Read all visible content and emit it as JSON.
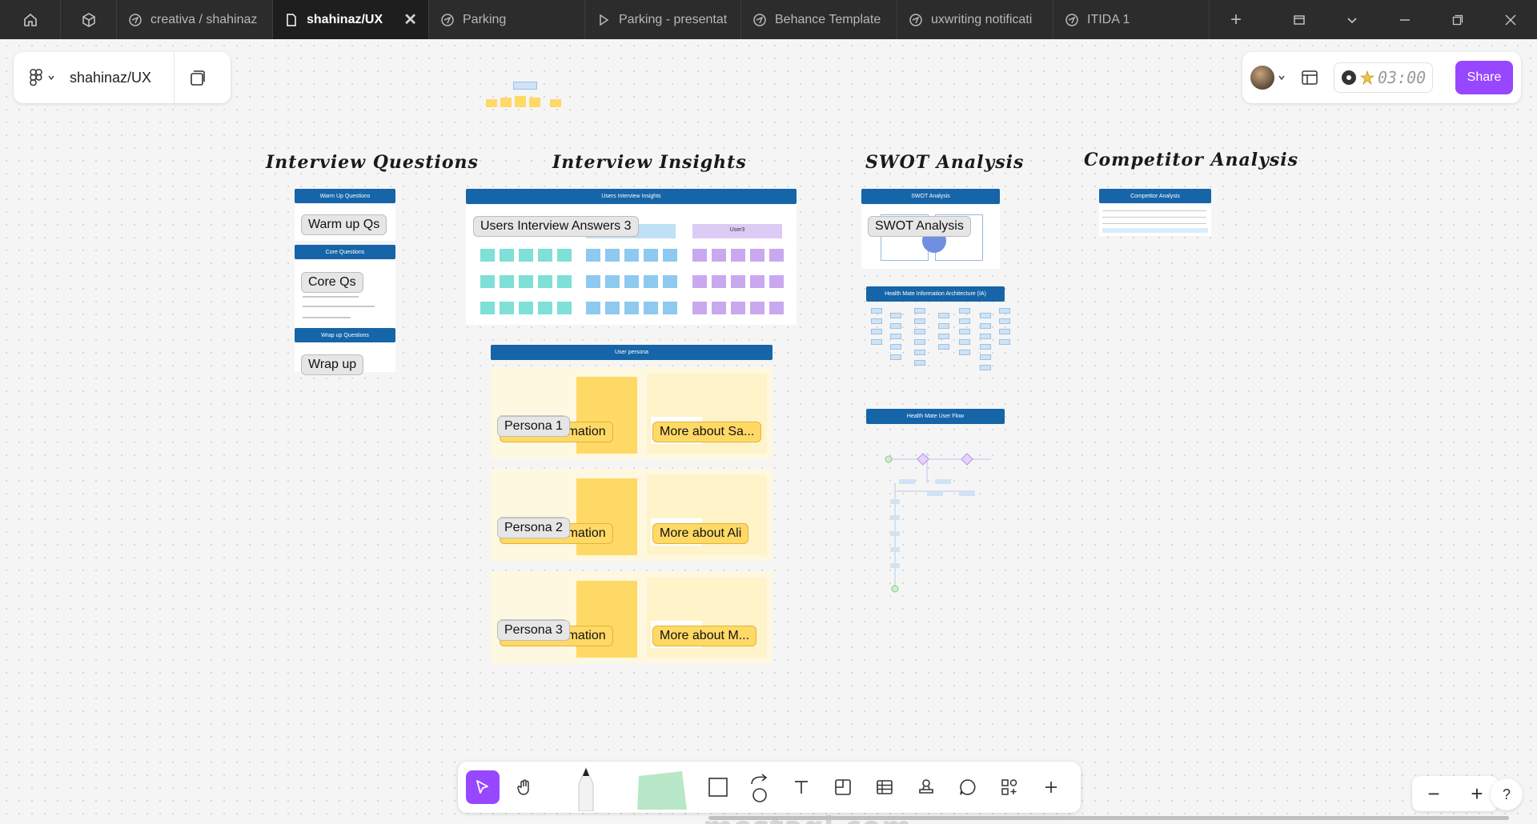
{
  "tabs": [
    {
      "label": "creativa / shahinaz"
    },
    {
      "label": "shahinaz/UX"
    },
    {
      "label": "Parking"
    },
    {
      "label": "Parking - presentat"
    },
    {
      "label": "Behance Template"
    },
    {
      "label": "uxwriting notificati"
    },
    {
      "label": "ITIDA 1"
    }
  ],
  "file": {
    "name": "shahinaz/UX"
  },
  "header": {
    "timer": "03:00",
    "share_label": "Share"
  },
  "sections": {
    "interview_questions": "Interview Questions",
    "interview_insights": "Interview Insights",
    "swot_analysis": "SWOT Analysis",
    "competitor_analysis": "Competitor Analysis"
  },
  "frames": {
    "warm_up_bar": "Warm Up Questions",
    "core_bar": "Core Questions",
    "wrap_up_bar": "Wrap up Questions",
    "users_interview_bar": "Users Interview Insights",
    "user_persona_bar": "User persona",
    "swot_bar": "SWOT Analysis",
    "ia_bar": "Health Mate Information Architecture (IA)",
    "user_flow_bar": "Health Mate User Flow",
    "competitor_bar": "Competitor Analysis",
    "user3_label": "User3"
  },
  "labels": {
    "warm_up": "Warm up Qs",
    "core": "Core Qs",
    "wrap_up": "Wrap up",
    "users_interview_answers": "Users Interview Answers 3",
    "swot": "SWOT Analysis",
    "persona_1": "Persona 1",
    "persona_2": "Persona 2",
    "persona_3": "Persona 3",
    "basic_info": "Basic Information",
    "more_sa": "More about Sa...",
    "more_ali": "More about Ali",
    "more_m": "More about M..."
  },
  "colors": {
    "accent": "#9747ff",
    "frame_blue": "#1565a8",
    "sticky_teal": "#7ee0d6",
    "sticky_blue": "#8ec9f0",
    "sticky_purple": "#c9a8f0",
    "sticky_yellow": "#ffd966"
  },
  "icons": [
    "home-icon",
    "cube-icon",
    "figjam-icon",
    "close-icon",
    "plus-icon",
    "minimize-icon",
    "maximize-icon",
    "chevron-down-icon",
    "pages-icon",
    "layout-icon",
    "move-icon",
    "hand-icon",
    "marker-icon",
    "sticky-icon",
    "shape-icon",
    "connector-icon",
    "text-icon",
    "section-icon",
    "table-icon",
    "stamp-icon",
    "comment-icon",
    "widget-icon",
    "zoom-out-icon",
    "zoom-in-icon",
    "help-icon"
  ],
  "zoom": {
    "minus": "−",
    "plus": "+",
    "help": "?"
  }
}
